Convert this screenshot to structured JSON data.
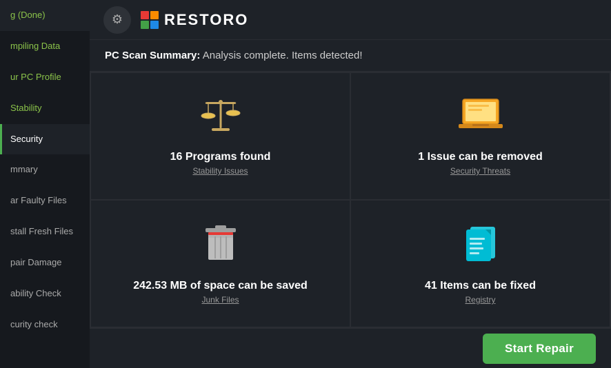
{
  "app": {
    "title": "RESTORO"
  },
  "header": {
    "gear_label": "⚙",
    "logo_emoji": "🟧",
    "title": "RESTORO"
  },
  "scan_summary": {
    "label": "PC Scan Summary:",
    "text": " Analysis complete. Items detected!"
  },
  "sidebar": {
    "items": [
      {
        "id": "scanning-done",
        "label": "g (Done)",
        "state": "done"
      },
      {
        "id": "compiling-data",
        "label": "mpiling Data",
        "state": "done"
      },
      {
        "id": "your-pc-profile",
        "label": "ur PC Profile",
        "state": "done"
      },
      {
        "id": "stability",
        "label": "Stability",
        "state": "done"
      },
      {
        "id": "security",
        "label": "Security",
        "state": "active"
      },
      {
        "id": "summary",
        "label": "mmary",
        "state": "normal"
      },
      {
        "id": "clear-faulty-files",
        "label": "ar Faulty Files",
        "state": "normal"
      },
      {
        "id": "install-fresh-files",
        "label": "stall Fresh Files",
        "state": "normal"
      },
      {
        "id": "repair-damage",
        "label": "pair Damage",
        "state": "normal"
      },
      {
        "id": "stability-check",
        "label": "ability Check",
        "state": "normal"
      },
      {
        "id": "security-check",
        "label": "curity check",
        "state": "normal"
      }
    ]
  },
  "cards": [
    {
      "id": "stability-issues",
      "icon_name": "scales-icon",
      "value": "16 Programs found",
      "label": "Stability Issues"
    },
    {
      "id": "security-threats",
      "icon_name": "laptop-icon",
      "value": "1 Issue can be removed",
      "label": "Security Threats"
    },
    {
      "id": "junk-files",
      "icon_name": "trash-icon",
      "value": "242.53 MB of space can be saved",
      "label": "Junk Files"
    },
    {
      "id": "registry",
      "icon_name": "registry-icon",
      "value": "41 Items can be fixed",
      "label": "Registry"
    }
  ],
  "footer": {
    "start_repair_label": "Start Repair"
  },
  "colors": {
    "accent_green": "#4caf50",
    "sidebar_bg": "#16191e",
    "main_bg": "#1e2228",
    "border": "#2a2d33"
  }
}
